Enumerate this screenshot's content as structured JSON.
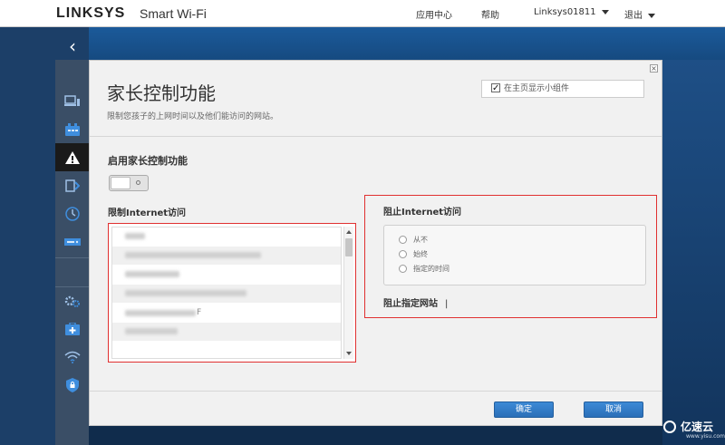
{
  "header": {
    "brand": "LINKSYS",
    "product": "Smart Wi-Fi",
    "nav": {
      "app_center": "应用中心",
      "help": "帮助",
      "account": "Linksys01811",
      "logout": "退出"
    }
  },
  "sidebar": {
    "back_icon": "chevron-left-icon",
    "items": [
      {
        "icon": "device-list-icon",
        "active": false
      },
      {
        "icon": "guest-access-icon",
        "active": false
      },
      {
        "icon": "parental-control-icon",
        "active": true
      },
      {
        "icon": "media-prioritization-icon",
        "active": false
      },
      {
        "icon": "speed-test-icon",
        "active": false
      },
      {
        "icon": "external-storage-icon",
        "active": false
      },
      {
        "icon": "connectivity-icon",
        "active": false
      },
      {
        "icon": "troubleshooting-icon",
        "active": false
      },
      {
        "icon": "wireless-icon",
        "active": false
      },
      {
        "icon": "security-icon",
        "active": false
      }
    ]
  },
  "modal": {
    "title": "家长控制功能",
    "description": "限制您孩子的上网时间以及他们能访问的网站。",
    "show_widget_label": "在主页显示小组件",
    "show_widget_checked": true,
    "enable_label": "启用家长控制功能",
    "enabled": false,
    "restrict_label": "限制Internet访问",
    "devices": [
      {
        "tail": ""
      },
      {
        "tail": ""
      },
      {
        "tail": ""
      },
      {
        "tail": ""
      },
      {
        "tail": "F"
      },
      {
        "tail": ""
      }
    ],
    "block_label": "阻止Internet访问",
    "block_options": [
      "从不",
      "始终",
      "指定的时间"
    ],
    "block_sites_label": "阻止指定网站",
    "ok_button": "确定",
    "cancel_button": "取消"
  },
  "watermark": {
    "text": "亿速云",
    "sub": "www.yisu.com"
  },
  "colors": {
    "accent": "#2b6fb8",
    "highlight_border": "#e03030",
    "sidebar_bg": "#1c3f68"
  }
}
